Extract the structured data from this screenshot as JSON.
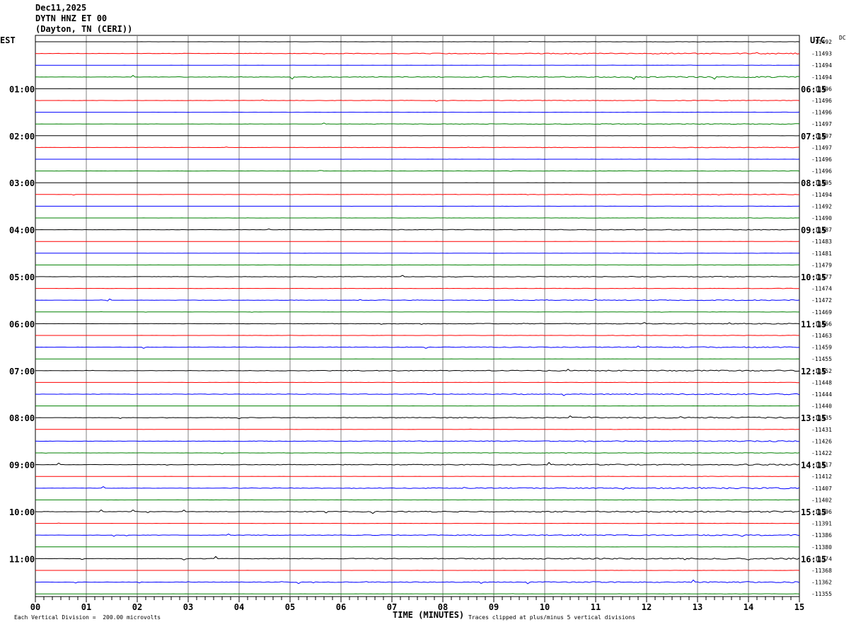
{
  "header": {
    "date": "Dec11,2025",
    "station": "DYTN HNZ ET 00",
    "location": "(Dayton, TN (CERI))"
  },
  "labels": {
    "left_timezone": "EST",
    "right_timezone": "UTC",
    "dc_header": "DC",
    "x_axis_title": "TIME (MINUTES)",
    "footer_scale": "Each Vertical Division =  200.00 microvolts",
    "footer_clip": "Traces clipped at plus/minus 5 vertical divisions"
  },
  "chart_data": {
    "type": "line",
    "title": "DYTN HNZ ET 00",
    "xlabel": "TIME (MINUTES)",
    "xlim": [
      0,
      15
    ],
    "x_ticks": [
      "00",
      "01",
      "02",
      "03",
      "04",
      "05",
      "06",
      "07",
      "08",
      "09",
      "10",
      "11",
      "12",
      "13",
      "14",
      "15"
    ],
    "row_colors": [
      "#000000",
      "#ff0000",
      "#0000ff",
      "#008000"
    ],
    "rows_per_hour": 4,
    "left_hour_labels": [
      "01:00",
      "02:00",
      "03:00",
      "04:00",
      "05:00",
      "06:00",
      "07:00",
      "08:00",
      "09:00",
      "10:00",
      "11:00"
    ],
    "right_hour_labels": [
      "06:15",
      "07:15",
      "08:15",
      "09:15",
      "10:15",
      "11:15",
      "12:15",
      "13:15",
      "14:15",
      "15:15",
      "16:15"
    ],
    "dc_offsets": [
      "-11492",
      "-11493",
      "-11494",
      "-11494",
      "-11496",
      "-11496",
      "-11496",
      "-11497",
      "-11497",
      "-11497",
      "-11496",
      "-11496",
      "-11495",
      "-11494",
      "-11492",
      "-11490",
      "-11487",
      "-11483",
      "-11481",
      "-11479",
      "-11477",
      "-11474",
      "-11472",
      "-11469",
      "-11466",
      "-11463",
      "-11459",
      "-11455",
      "-11452",
      "-11448",
      "-11444",
      "-11440",
      "-11435",
      "-11431",
      "-11426",
      "-11422",
      "-11417",
      "-11412",
      "-11407",
      "-11402",
      "-11396",
      "-11391",
      "-11386",
      "-11380",
      "-11374",
      "-11368",
      "-11362",
      "-11355"
    ],
    "row_noise_level": [
      0.2,
      0.8,
      0.2,
      0.9,
      0.1,
      0.4,
      0.2,
      0.5,
      0.1,
      0.4,
      0.1,
      0.3,
      0.1,
      0.4,
      0.1,
      0.2,
      0.5,
      0.1,
      0.2,
      0.2,
      0.6,
      0.3,
      0.6,
      0.2,
      0.6,
      0.2,
      0.7,
      0.1,
      0.8,
      0.2,
      0.8,
      0.1,
      0.9,
      0.2,
      0.8,
      0.4,
      0.9,
      0.2,
      0.9,
      0.2,
      1.0,
      0.2,
      0.8,
      0.1,
      0.9,
      0.1,
      0.8,
      0.2
    ],
    "units": "microvolts",
    "vertical_division": 200.0
  }
}
